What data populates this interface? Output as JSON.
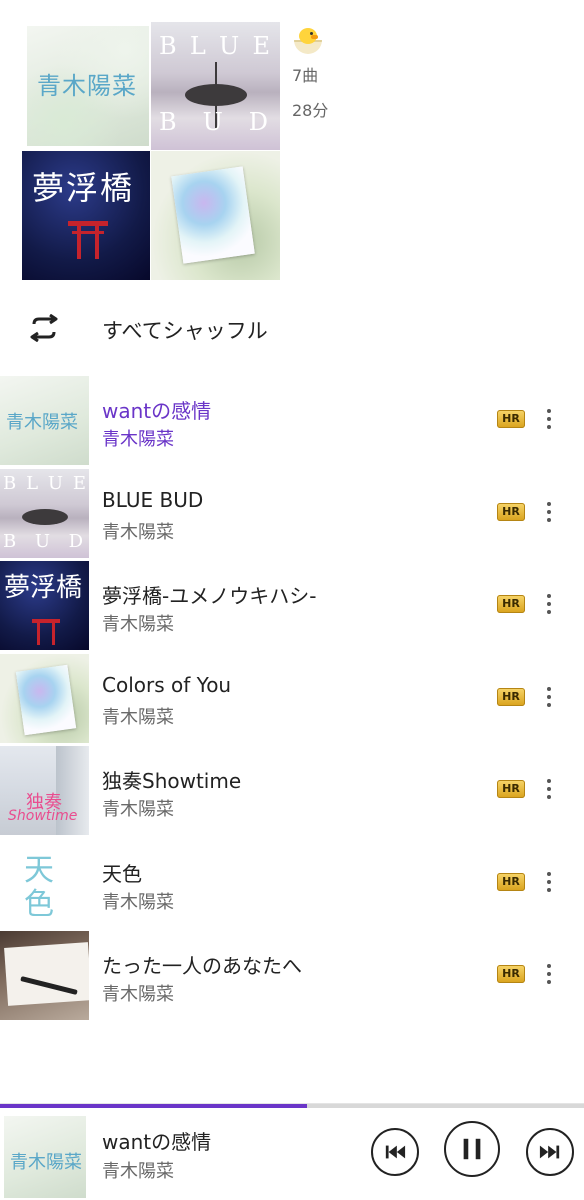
{
  "album": {
    "tile1_title": "青木陽菜",
    "tile2_letters_top": [
      "B",
      "L",
      "U",
      "E"
    ],
    "tile2_letters_bottom": [
      "B",
      "U",
      "D"
    ],
    "tile3_title": "夢浮橋",
    "track_count": "7曲",
    "duration": "28分",
    "badge_icon": "chick-in-egg-icon"
  },
  "shuffle": {
    "label": "すべてシャッフル",
    "icon": "shuffle-icon"
  },
  "tracks": [
    {
      "title": "wantの感情",
      "artist": "青木陽菜",
      "badge": "HR",
      "active": true
    },
    {
      "title": "BLUE BUD",
      "artist": "青木陽菜",
      "badge": "HR",
      "active": false
    },
    {
      "title": "夢浮橋-ユメノウキハシ-",
      "artist": "青木陽菜",
      "badge": "HR",
      "active": false
    },
    {
      "title": "Colors of You",
      "artist": "青木陽菜",
      "badge": "HR",
      "active": false
    },
    {
      "title": "独奏Showtime",
      "artist": "青木陽菜",
      "badge": "HR",
      "active": false
    },
    {
      "title": "天色",
      "artist": "青木陽菜",
      "badge": "HR",
      "active": false
    },
    {
      "title": "たった一人のあなたへ",
      "artist": "青木陽菜",
      "badge": "HR",
      "active": false
    }
  ],
  "thumb_text": {
    "t1": "青木陽菜",
    "t3": "夢浮橋",
    "t5_a": "独奏",
    "t5_b": "Showtime",
    "t6_a": "天",
    "t6_b": "色"
  },
  "now_playing": {
    "title": "wantの感情",
    "artist": "青木陽菜",
    "progress": 0.525
  },
  "colors": {
    "accent": "#6a35c8",
    "hr_badge": "#e9bb3a"
  }
}
